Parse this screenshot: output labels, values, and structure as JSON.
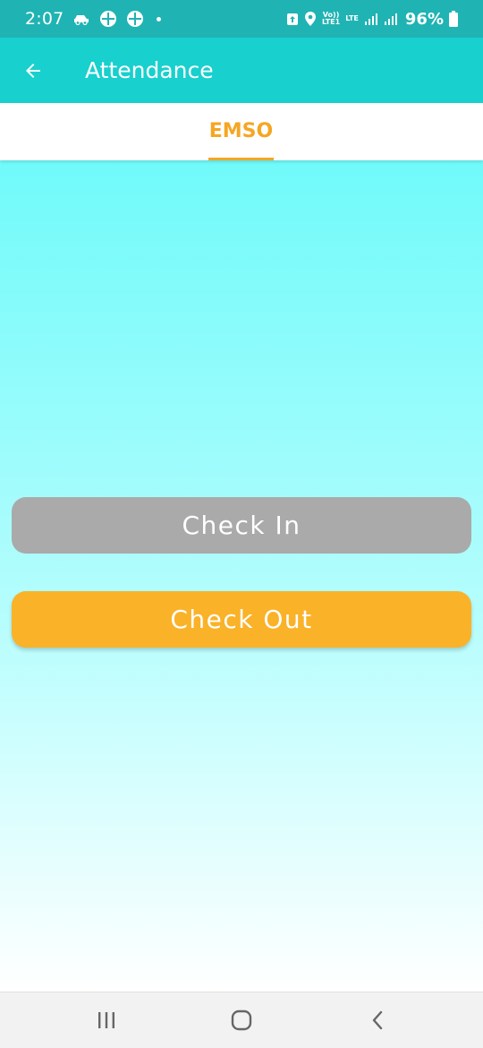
{
  "status_bar": {
    "time": "2:07",
    "network_volte": "Vo))",
    "network_lte1": "LTE1",
    "network_lte": "LTE",
    "battery_percent": "96%",
    "icons": [
      "car-icon",
      "app-icon",
      "app-icon",
      "dot-icon",
      "shield-icon",
      "location-icon",
      "signal-icon",
      "signal-icon",
      "battery-icon"
    ]
  },
  "toolbar": {
    "title": "Attendance",
    "back_icon": "arrow-left-icon"
  },
  "tabs": [
    {
      "label": "EMSO",
      "selected": true
    }
  ],
  "colors": {
    "status_bar": "#20b3b3",
    "toolbar": "#18d0ce",
    "accent": "#f5a623",
    "check_in": "#aaaaaa",
    "check_out": "#fab229",
    "gradient_top": "#70fafa",
    "gradient_bottom": "#ffffff"
  },
  "actions": {
    "check_in_label": "Check In",
    "check_out_label": "Check Out"
  },
  "nav_bar": {
    "icons": [
      "recent-apps-icon",
      "home-icon",
      "back-icon"
    ]
  }
}
